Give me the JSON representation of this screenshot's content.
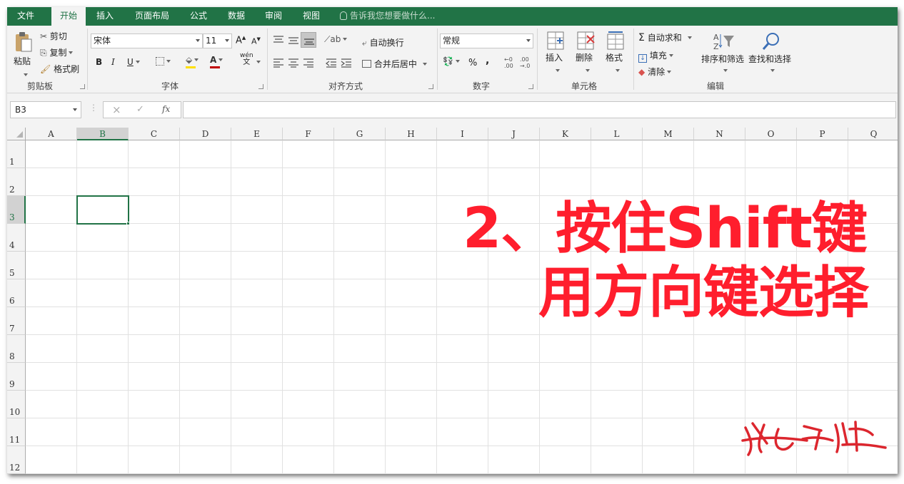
{
  "tabs": [
    {
      "label": "文件",
      "active": false
    },
    {
      "label": "开始",
      "active": true
    },
    {
      "label": "插入",
      "active": false
    },
    {
      "label": "页面布局",
      "active": false
    },
    {
      "label": "公式",
      "active": false
    },
    {
      "label": "数据",
      "active": false
    },
    {
      "label": "审阅",
      "active": false
    },
    {
      "label": "视图",
      "active": false
    }
  ],
  "tell_me": "告诉我您想要做什么...",
  "clipboard": {
    "paste": "粘贴",
    "cut": "剪切",
    "copy": "复制",
    "format_painter": "格式刷",
    "group": "剪贴板"
  },
  "font": {
    "name": "宋体",
    "size": "11",
    "bold": "B",
    "italic": "I",
    "underline": "U",
    "grow": "A",
    "shrink": "A",
    "phonetic_top": "wén",
    "phonetic_bottom": "文",
    "group": "字体"
  },
  "alignment": {
    "wrap_text": "自动换行",
    "merge_center": "合并后居中",
    "group": "对齐方式"
  },
  "number": {
    "format": "常规",
    "percent": "%",
    "comma": ",",
    "group": "数字"
  },
  "cells": {
    "insert": "插入",
    "delete": "删除",
    "format": "格式",
    "group": "单元格"
  },
  "editing": {
    "autosum": "自动求和",
    "fill": "填充",
    "clear": "清除",
    "sort_filter": "排序和筛选",
    "find_select": "查找和选择",
    "group": "编辑"
  },
  "formula_bar": {
    "name_box": "B3",
    "fx": "fx",
    "cancel": "×",
    "enter": "✓",
    "value": ""
  },
  "columns": [
    "A",
    "B",
    "C",
    "D",
    "E",
    "F",
    "G",
    "H",
    "I",
    "J",
    "K",
    "L",
    "M",
    "N",
    "O",
    "P",
    "Q"
  ],
  "rows": [
    "1",
    "2",
    "3",
    "4",
    "5",
    "6",
    "7",
    "8",
    "9",
    "10",
    "11",
    "12"
  ],
  "selected_cell": {
    "column": "B",
    "row": "3"
  },
  "overlay": {
    "line1": "2、按住Shift键",
    "line2": "用方向键选择",
    "color": "#ff1e2d"
  },
  "signature_text": "张之峰",
  "colors": {
    "accent": "#217346",
    "ribbon": "#f3f3f3",
    "font_color_bar": "#c00000",
    "fill_color_bar": "#ffe000"
  }
}
